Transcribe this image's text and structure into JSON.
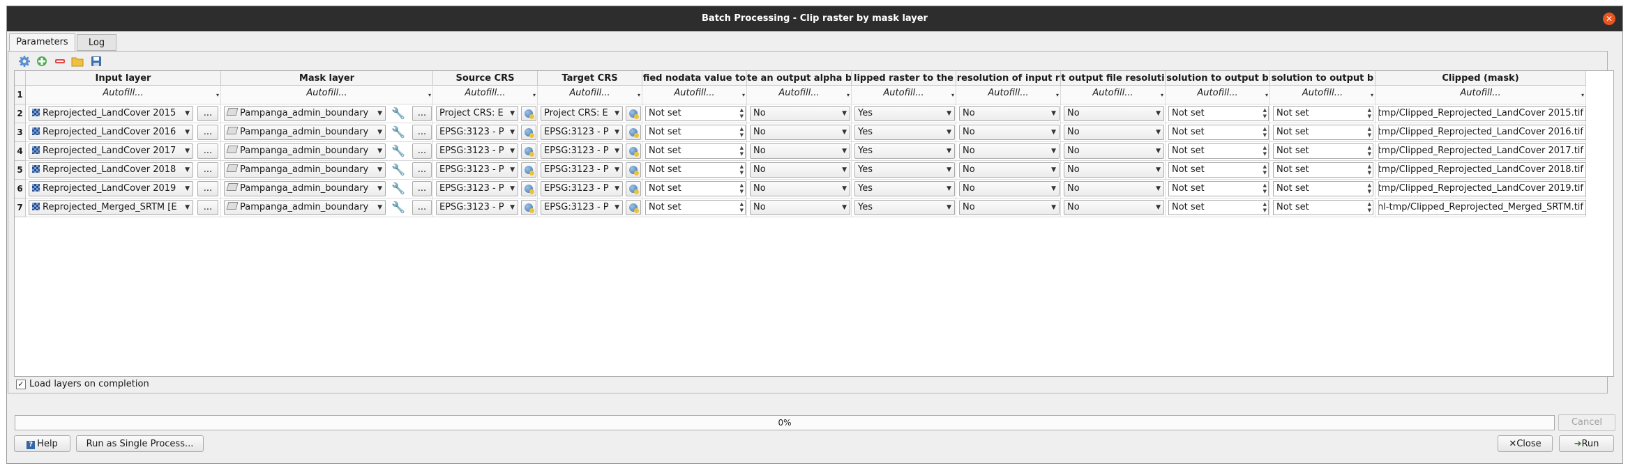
{
  "window": {
    "title": "Batch Processing - Clip raster by mask layer"
  },
  "tabs": [
    "Parameters",
    "Log"
  ],
  "toolbar": {
    "icons": [
      "gear-icon",
      "add-row-icon",
      "remove-row-icon",
      "open-folder-icon",
      "save-icon"
    ]
  },
  "table": {
    "headers": [
      "Input layer",
      "Mask layer",
      "Source CRS",
      "Target CRS",
      "fied nodata value to",
      "te an output alpha b",
      "lipped raster to the",
      "resolution of input r",
      "t output file resoluti",
      "solution to output b",
      "solution to output b",
      "Clipped (mask)"
    ],
    "autofill_row_num": "1",
    "autofill_label": "Autofill...",
    "browse_label": "...",
    "rows": [
      {
        "num": "2",
        "input": "Reprojected_LandCover 2015",
        "mask": "Pampanga_admin_boundary",
        "src": "Project CRS: E",
        "tgt": "Project CRS: E",
        "nodata": "Not set",
        "alpha": "No",
        "clip": "Yes",
        "keepres": "No",
        "setres": "No",
        "xres": "Not set",
        "yres": "Not set",
        "out": "tmp/Clipped_Reprojected_LandCover 2015.tif"
      },
      {
        "num": "3",
        "input": "Reprojected_LandCover 2016",
        "mask": "Pampanga_admin_boundary",
        "src": "EPSG:3123 - P",
        "tgt": "EPSG:3123 - P",
        "nodata": "Not set",
        "alpha": "No",
        "clip": "Yes",
        "keepres": "No",
        "setres": "No",
        "xres": "Not set",
        "yres": "Not set",
        "out": "tmp/Clipped_Reprojected_LandCover 2016.tif"
      },
      {
        "num": "4",
        "input": "Reprojected_LandCover 2017",
        "mask": "Pampanga_admin_boundary",
        "src": "EPSG:3123 - P",
        "tgt": "EPSG:3123 - P",
        "nodata": "Not set",
        "alpha": "No",
        "clip": "Yes",
        "keepres": "No",
        "setres": "No",
        "xres": "Not set",
        "yres": "Not set",
        "out": "tmp/Clipped_Reprojected_LandCover 2017.tif"
      },
      {
        "num": "5",
        "input": "Reprojected_LandCover 2018",
        "mask": "Pampanga_admin_boundary",
        "src": "EPSG:3123 - P",
        "tgt": "EPSG:3123 - P",
        "nodata": "Not set",
        "alpha": "No",
        "clip": "Yes",
        "keepres": "No",
        "setres": "No",
        "xres": "Not set",
        "yres": "Not set",
        "out": "tmp/Clipped_Reprojected_LandCover 2018.tif"
      },
      {
        "num": "6",
        "input": "Reprojected_LandCover 2019",
        "mask": "Pampanga_admin_boundary",
        "src": "EPSG:3123 - P",
        "tgt": "EPSG:3123 - P",
        "nodata": "Not set",
        "alpha": "No",
        "clip": "Yes",
        "keepres": "No",
        "setres": "No",
        "xres": "Not set",
        "yres": "Not set",
        "out": "tmp/Clipped_Reprojected_LandCover 2019.tif"
      },
      {
        "num": "7",
        "input": "Reprojected_Merged_SRTM [E",
        "mask": "Pampanga_admin_boundary",
        "src": "EPSG:3123 - P",
        "tgt": "EPSG:3123 - P",
        "nodata": "Not set",
        "alpha": "No",
        "clip": "Yes",
        "keepres": "No",
        "setres": "No",
        "xres": "Not set",
        "yres": "Not set",
        "out": "nl-tmp/Clipped_Reprojected_Merged_SRTM.tif"
      }
    ]
  },
  "load_layers": {
    "label": "Load layers on completion",
    "checked": true,
    "mark": "✓"
  },
  "progress": {
    "value": 0,
    "label": "0%"
  },
  "buttons": {
    "cancel": "Cancel",
    "help": "Help",
    "run_single": "Run as Single Process...",
    "close": "Close",
    "run": "Run"
  },
  "colors": {
    "titlebar": "#2d2d2d",
    "close_accent": "#e95420"
  }
}
